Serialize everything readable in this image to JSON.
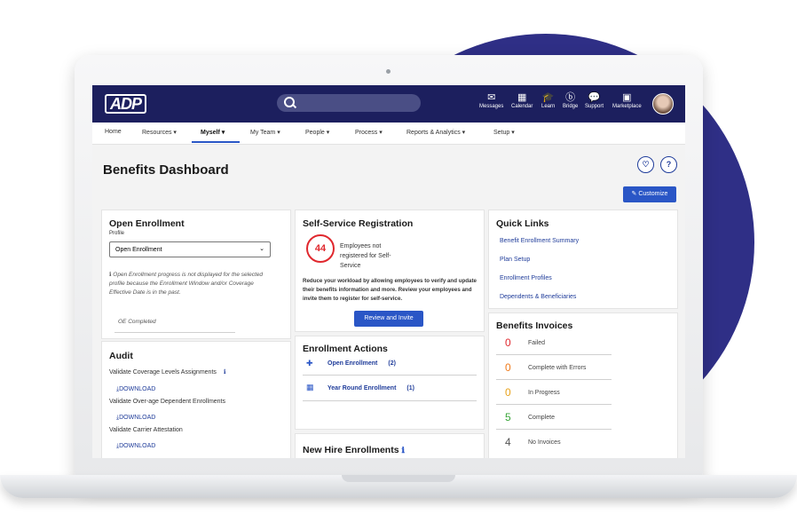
{
  "topbar": {
    "logo": "ADP",
    "icons": [
      {
        "name": "messages-icon",
        "label": "Messages",
        "glyph": "✉"
      },
      {
        "name": "calendar-icon",
        "label": "Calendar",
        "glyph": "▦"
      },
      {
        "name": "learn-icon",
        "label": "Learn",
        "glyph": "🎓"
      },
      {
        "name": "bridge-icon",
        "label": "Bridge",
        "glyph": "ⓑ"
      },
      {
        "name": "support-icon",
        "label": "Support",
        "glyph": "💬"
      },
      {
        "name": "marketplace-icon",
        "label": "Marketplace",
        "glyph": "▣"
      }
    ]
  },
  "menu": [
    "Home",
    "Resources ▾",
    "Myself ▾",
    "My Team ▾",
    "People ▾",
    "Process ▾",
    "Reports & Analytics ▾",
    "Setup ▾"
  ],
  "page_title": "Benefits Dashboard",
  "buttons": {
    "favorite": "♡",
    "help": "?",
    "customize": "✎ Customize"
  },
  "open_enrollment": {
    "title": "Open Enrollment",
    "profile_label": "Profile",
    "profile_value": "Open Enrollment",
    "note": "Open Enrollment progress is not displayed for the selected profile because the Enrollment Window and/or Coverage Effective Date is in the past.",
    "status": "OE Completed"
  },
  "audit": {
    "title": "Audit",
    "items": [
      {
        "label": "Validate Coverage Levels Assignments",
        "action": "DOWNLOAD"
      },
      {
        "label": "Validate Over-age Dependent Enrollments",
        "action": "DOWNLOAD"
      },
      {
        "label": "Validate Carrier Attestation",
        "action": "DOWNLOAD"
      }
    ]
  },
  "self_service": {
    "title": "Self-Service Registration",
    "count": "44",
    "count_label": "Employees not registered for Self-Service",
    "description": "Reduce your workload by allowing employees to verify and update their benefits information and more. Review your employees and invite them to register for self-service.",
    "button": "Review and Invite"
  },
  "enrollment_actions": {
    "title": "Enrollment Actions",
    "items": [
      {
        "label": "Open Enrollment",
        "count": "(2)"
      },
      {
        "label": "Year Round Enrollment",
        "count": "(1)"
      }
    ]
  },
  "new_hire": {
    "title": "New Hire Enrollments"
  },
  "quick_links": {
    "title": "Quick Links",
    "links": [
      "Benefit Enrollment Summary",
      "Plan Setup",
      "Enrollment Profiles",
      "Dependents & Beneficiaries"
    ]
  },
  "invoices": {
    "title": "Benefits Invoices",
    "rows": [
      {
        "count": "0",
        "label": "Failed",
        "color": "#e0282e"
      },
      {
        "count": "0",
        "label": "Complete with Errors",
        "color": "#f07a1a"
      },
      {
        "count": "0",
        "label": "In Progress",
        "color": "#e8a21a"
      },
      {
        "count": "5",
        "label": "Complete",
        "color": "#3aa63a"
      },
      {
        "count": "4",
        "label": "No Invoices",
        "color": "#555555"
      }
    ]
  }
}
